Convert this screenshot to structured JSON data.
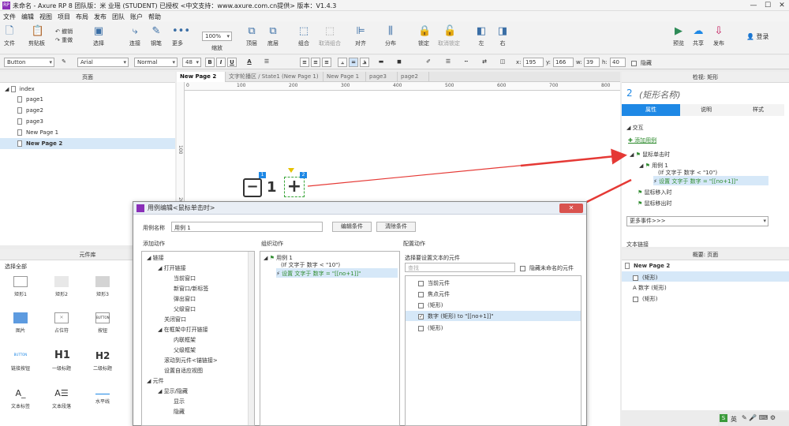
{
  "window": {
    "title": "未命名 - Axure RP 8 团队版：米 业瑶 (STUDENT) 已授权    <中文支持：www.axure.com.cn提供> 版本：V1.4.3",
    "app_icon": "RP"
  },
  "menu": [
    "文件",
    "编辑",
    "视图",
    "项目",
    "布局",
    "发布",
    "团队",
    "账户",
    "帮助"
  ],
  "toolbar": {
    "file": "文件",
    "clipboard": "剪贴板",
    "undo": "撤销",
    "redo": "重做",
    "select": "选择",
    "connect": "连接",
    "pen": "钢笔",
    "more": "更多",
    "zoom_value": "100%",
    "zoom": "缩放",
    "top": "顶层",
    "bottom": "底层",
    "group": "组合",
    "ungroup": "取消组合",
    "align": "对齐",
    "distribute": "分布",
    "lock": "锁定",
    "unlock": "取消锁定",
    "left": "左",
    "right": "右",
    "preview": "预览",
    "share": "共享",
    "publish": "发布",
    "login": "登录"
  },
  "format": {
    "widget_type": "Button",
    "font": "Arial",
    "style": "Normal",
    "size": "48",
    "bold": "B",
    "italic": "I",
    "underline": "U",
    "x_label": "x:",
    "x": "195",
    "y_label": "y:",
    "y": "166",
    "w_label": "w:",
    "w": "39",
    "h_label": "h:",
    "h": "40",
    "hidden": "隐藏"
  },
  "pages_panel": {
    "title": "页面",
    "root": "index",
    "pages": [
      "page1",
      "page2",
      "page3",
      "New Page 1",
      "New Page 2"
    ]
  },
  "tabs": [
    "New Page 2",
    "文字轮播区 / State1 (New Page 1)",
    "New Page 1",
    "page3",
    "page2"
  ],
  "ruler": {
    "h": [
      "0",
      "100",
      "200",
      "300",
      "400",
      "500",
      "600",
      "700",
      "800"
    ],
    "v": [
      "100",
      "200"
    ]
  },
  "canvas": {
    "minus": "−",
    "number": "1",
    "plus": "+",
    "badge1": "1",
    "badge2": "2"
  },
  "library": {
    "title": "元件库",
    "select": "选择全部",
    "items": [
      "矩形1",
      "矩形2",
      "矩形3",
      "图片",
      "占位符",
      "按钮",
      "链接按钮",
      "一级标题",
      "二级标题",
      "文本标签",
      "文本段落",
      "水平线"
    ],
    "button_text": "BUTTON",
    "h1": "H1",
    "h2": "H2",
    "link_text": "BUTTON"
  },
  "inspector": {
    "title": "检视: 矩形",
    "number": "2",
    "name": "(矩形名称)",
    "tabs": [
      "属性",
      "说明",
      "样式"
    ],
    "interaction": "交互",
    "add_case": "添加用例",
    "event_click": "鼠标单击时",
    "case1": "用例 1",
    "condition": "(If 文字于 数字 < \"10\")",
    "action": "设置 文字于 数字 = \"[[no+1]]\"",
    "event_enter": "鼠标移入时",
    "event_leave": "鼠标移出时",
    "more_events": "更多事件>>>",
    "text_link": "文本链接"
  },
  "outline": {
    "title": "概要: 页面",
    "page": "New Page 2",
    "items": [
      "(矩形)",
      "数字 (矩形)",
      "(矩形)"
    ]
  },
  "dialog": {
    "title": "用例编辑<鼠标单击时>",
    "case_name_label": "用例名称",
    "case_name": "用例 1",
    "edit_condition": "编辑条件",
    "clear_condition": "清除条件",
    "col1": "添加动作",
    "col2": "组织动作",
    "col3": "配置动作",
    "actions": [
      "链接",
      "打开链接",
      "当前窗口",
      "新窗口/新标签",
      "弹出窗口",
      "父级窗口",
      "关闭窗口",
      "在框架中打开链接",
      "内联框架",
      "父级框架",
      "滚动到元件<锚链接>",
      "设置自适应视图",
      "元件",
      "显示/隐藏",
      "显示",
      "隐藏"
    ],
    "org_case": "用例 1",
    "org_condition": "(If 文字于 数字 < \"10\")",
    "org_action": "设置 文字于 数字 = \"[[no+1]]\"",
    "config_title": "选择要设置文本的元件",
    "search_placeholder": "查找",
    "hide_unnamed": "隐藏未命名的元件",
    "targets": [
      "当前元件",
      "焦点元件",
      "(矩形)",
      "数字 (矩形) to \"[[no+1]]\"",
      "(矩形)"
    ]
  },
  "taskbar": {
    "ime": "英"
  },
  "colors": {
    "accent": "#1e88e5",
    "arrow": "#e53935",
    "selected": "#d6e8f8"
  }
}
